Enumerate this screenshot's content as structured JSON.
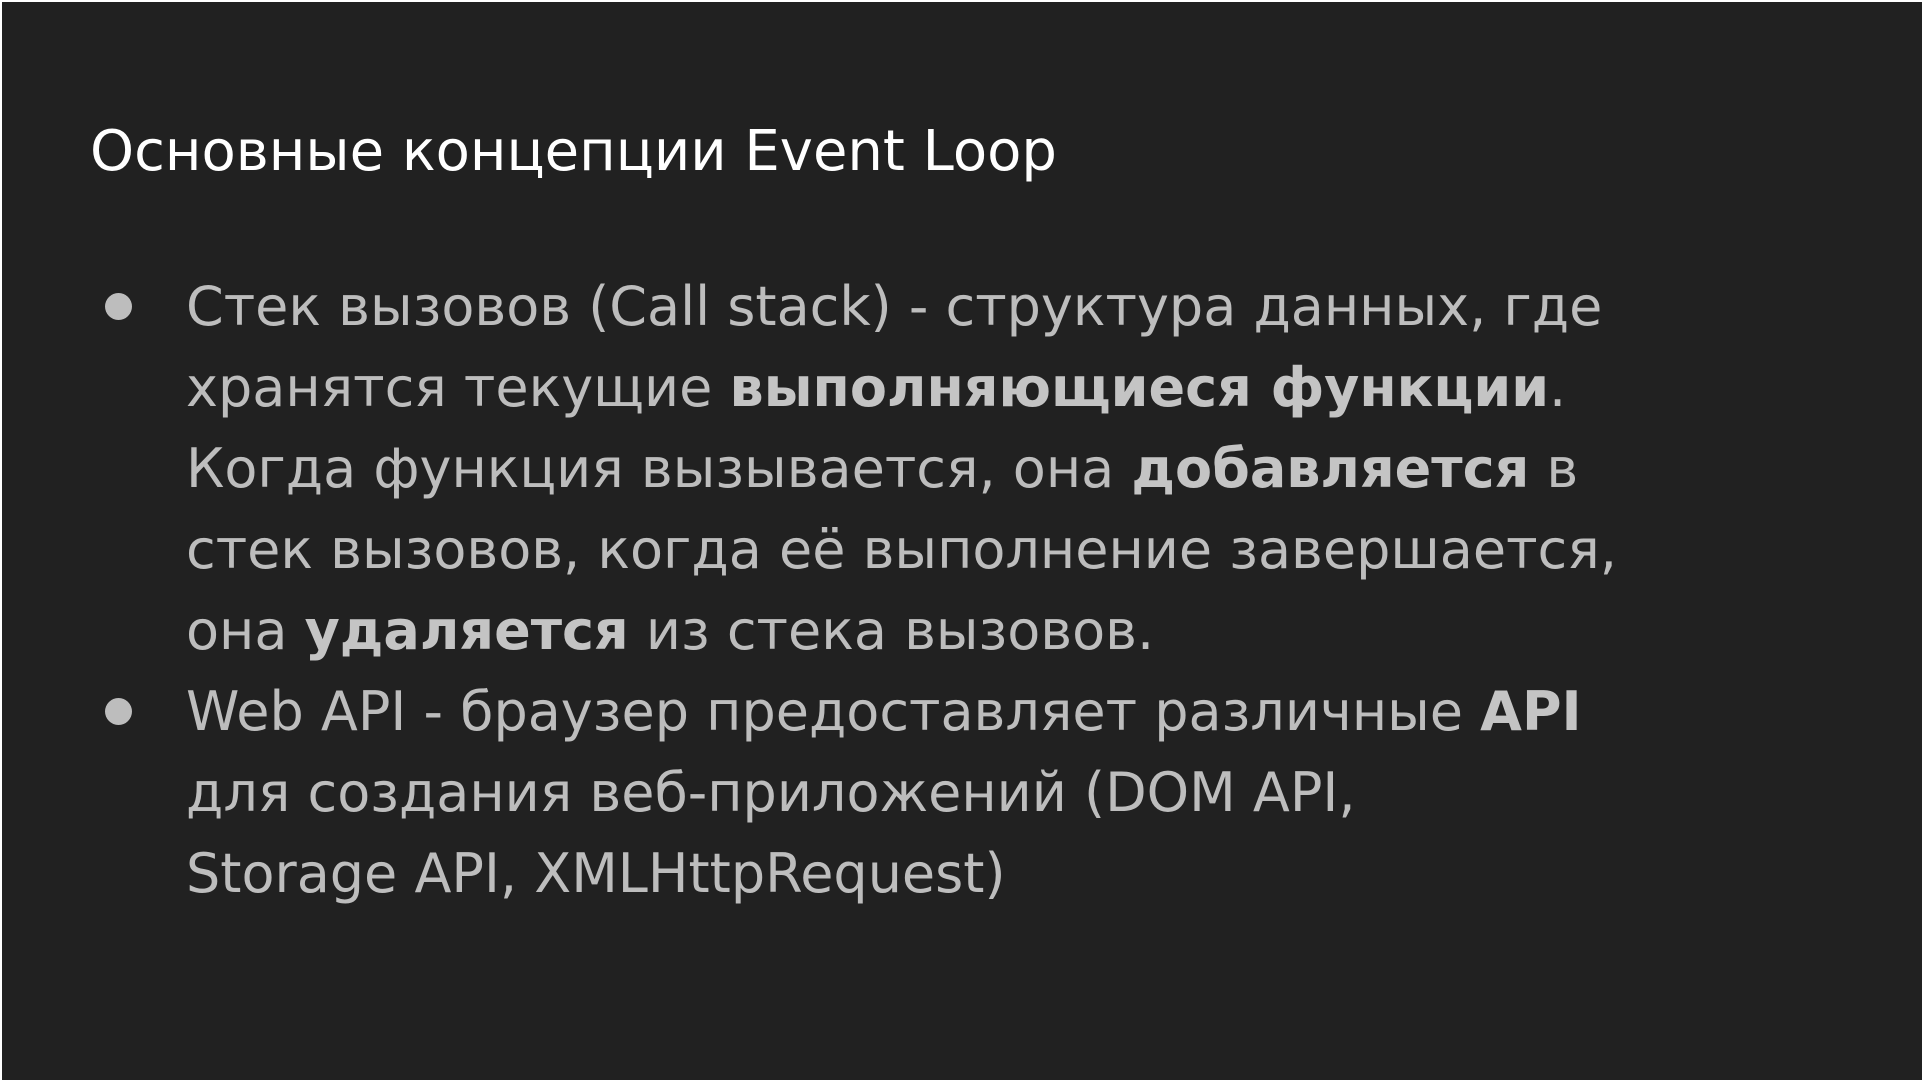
{
  "slide": {
    "title": "Основные концепции Event Loop",
    "bullets": [
      {
        "lines": [
          [
            {
              "text": "Стек вызовов (Call stack) - структура данных, где",
              "bold": false
            }
          ],
          [
            {
              "text": "хранятся текущие ",
              "bold": false
            },
            {
              "text": "выполняющиеся функции",
              "bold": true
            },
            {
              "text": ".",
              "bold": false
            }
          ],
          [
            {
              "text": "Когда функция вызывается, она ",
              "bold": false
            },
            {
              "text": "добавляется",
              "bold": true
            },
            {
              "text": " в",
              "bold": false
            }
          ],
          [
            {
              "text": "стек вызовов, когда её выполнение завершается,",
              "bold": false
            }
          ],
          [
            {
              "text": "она ",
              "bold": false
            },
            {
              "text": "удаляется",
              "bold": true
            },
            {
              "text": " из стека вызовов.",
              "bold": false
            }
          ]
        ]
      },
      {
        "lines": [
          [
            {
              "text": "Web API - браузер предоставляет различные ",
              "bold": false
            },
            {
              "text": "API",
              "bold": true
            }
          ],
          [
            {
              "text": "для создания веб-приложений (DOM API,",
              "bold": false
            }
          ],
          [
            {
              "text": "Storage API, XMLHttpRequest)",
              "bold": false
            }
          ]
        ]
      }
    ]
  },
  "colors": {
    "background": "#212121",
    "title": "#ffffff",
    "body_text": "#bdbdbd",
    "bold_text": "#c4c4c4"
  }
}
